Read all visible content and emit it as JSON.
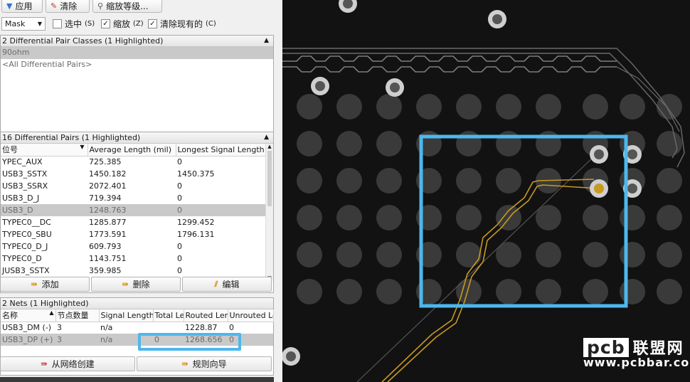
{
  "toolbar": {
    "apply_label": "应用",
    "clear_label": "清除",
    "zoom_level_label": "缩放等级..."
  },
  "options": {
    "mask_value": "Mask",
    "select_label": "选中",
    "select_key": "(S)",
    "zoom_label": "缩放",
    "zoom_key": "(Z)",
    "clear_existing_label": "清除现有的",
    "clear_existing_key": "(C)",
    "select_checked": false,
    "zoom_checked": true,
    "clear_existing_checked": true
  },
  "classes_panel": {
    "title": "2 Differential Pair Classes (1 Highlighted)",
    "items": [
      "90ohm",
      "<All Differential Pairs>"
    ]
  },
  "pairs_panel": {
    "title": "16 Differential Pairs (1 Highlighted)",
    "columns": [
      "位号",
      "Average Length (mil)",
      "Longest Signal Length (mil)"
    ],
    "rows": [
      [
        "YPEC_AUX",
        "725.385",
        "0"
      ],
      [
        "USB3_SSTX",
        "1450.182",
        "1450.375"
      ],
      [
        "USB3_SSRX",
        "2072.401",
        "0"
      ],
      [
        "USB3_D_J",
        "719.394",
        "0"
      ],
      [
        "USB3_D",
        "1248.763",
        "0"
      ],
      [
        "TYPEC0__DC",
        "1285.877",
        "1299.452"
      ],
      [
        "TYPEC0_SBU",
        "1773.591",
        "1796.131"
      ],
      [
        "TYPEC0_D_J",
        "609.793",
        "0"
      ],
      [
        "TYPEC0_D",
        "1143.751",
        "0"
      ],
      [
        "JUSB3_SSTX",
        "359.985",
        "0"
      ]
    ],
    "highlighted_row": 4,
    "add_label": "添加",
    "delete_label": "删除",
    "edit_label": "编辑"
  },
  "nets_panel": {
    "title": "2 Nets (1 Highlighted)",
    "columns": [
      "名称",
      "节点数量",
      "Signal Length",
      "Total Length",
      "Routed Length",
      "Unrouted Length"
    ],
    "rows": [
      [
        "USB3_DM (-)",
        "3",
        "n/a",
        "",
        "1228.87",
        "0"
      ],
      [
        "USB3_DP (+)",
        "3",
        "n/a",
        "0",
        "1268.656",
        "0"
      ]
    ],
    "highlighted_row": 1,
    "create_from_nets_label": "从网络创建",
    "rule_wizard_label": "规则向导"
  },
  "watermark": {
    "brand": "pcb",
    "brand_cn": "联盟网",
    "url": "www.pcbbar.com"
  },
  "colors": {
    "highlight_box": "#4db8ec",
    "trace_gold": "#c99a22",
    "pad_gray": "#3a3a3a",
    "board_bg": "#121212"
  }
}
